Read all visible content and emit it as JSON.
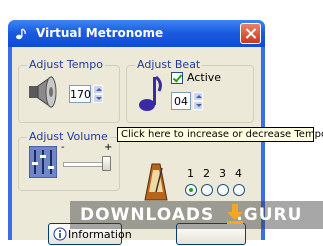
{
  "window": {
    "title": "Virtual Metronome"
  },
  "tempo": {
    "group_label": "Adjust Tempo",
    "value": "170"
  },
  "beat": {
    "group_label": "Adjust Beat",
    "active_label": "Active",
    "active_checked": true,
    "value": "04"
  },
  "volume": {
    "group_label": "Adjust Volume",
    "min_label": "-",
    "max_label": "+"
  },
  "beat_selector": {
    "labels": [
      "1",
      "2",
      "3",
      "4"
    ],
    "selected": "1"
  },
  "buttons": {
    "info_label": "Information"
  },
  "tooltip": {
    "text": "Click here to increase or decrease Tempo"
  },
  "watermark": {
    "text": "DOWNLOADS",
    "suffix": ".GURU"
  },
  "colors": {
    "title_bar": "#0f4bd6",
    "group_label": "#1f3b9e",
    "tooltip_bg": "#ffffe1",
    "accent_green": "#21a121"
  }
}
